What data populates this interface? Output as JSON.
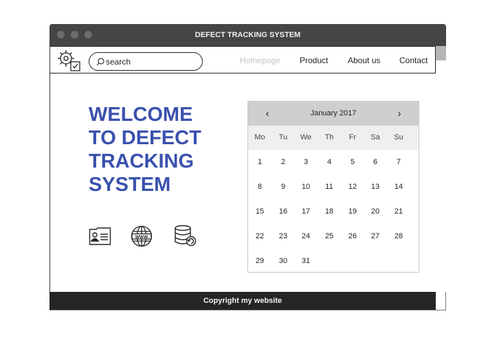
{
  "window": {
    "title": "DEFECT TRACKING SYSTEM"
  },
  "nav": {
    "search_placeholder": "search",
    "links": [
      "Homepage",
      "Product",
      "About us",
      "Contact"
    ]
  },
  "hero": {
    "lines": [
      "WELCOME",
      "TO DEFECT",
      "TRACKING",
      "SYSTEM"
    ],
    "color": "#3a51ad"
  },
  "feature_icons": [
    "contact-card-icon",
    "www-globe-icon",
    "database-sync-icon"
  ],
  "calendar": {
    "month_label": "January 2017",
    "prev_label": "‹",
    "next_label": "›",
    "weekdays": [
      "Mo",
      "Tu",
      "We",
      "Th",
      "Fr",
      "Sa",
      "Su"
    ],
    "days": [
      "1",
      "2",
      "3",
      "4",
      "5",
      "6",
      "7",
      "8",
      "9",
      "10",
      "11",
      "12",
      "13",
      "14",
      "15",
      "16",
      "17",
      "18",
      "19",
      "20",
      "21",
      "22",
      "23",
      "24",
      "25",
      "26",
      "27",
      "28",
      "29",
      "30",
      "31"
    ]
  },
  "footer": {
    "text": "Copyright my website"
  }
}
